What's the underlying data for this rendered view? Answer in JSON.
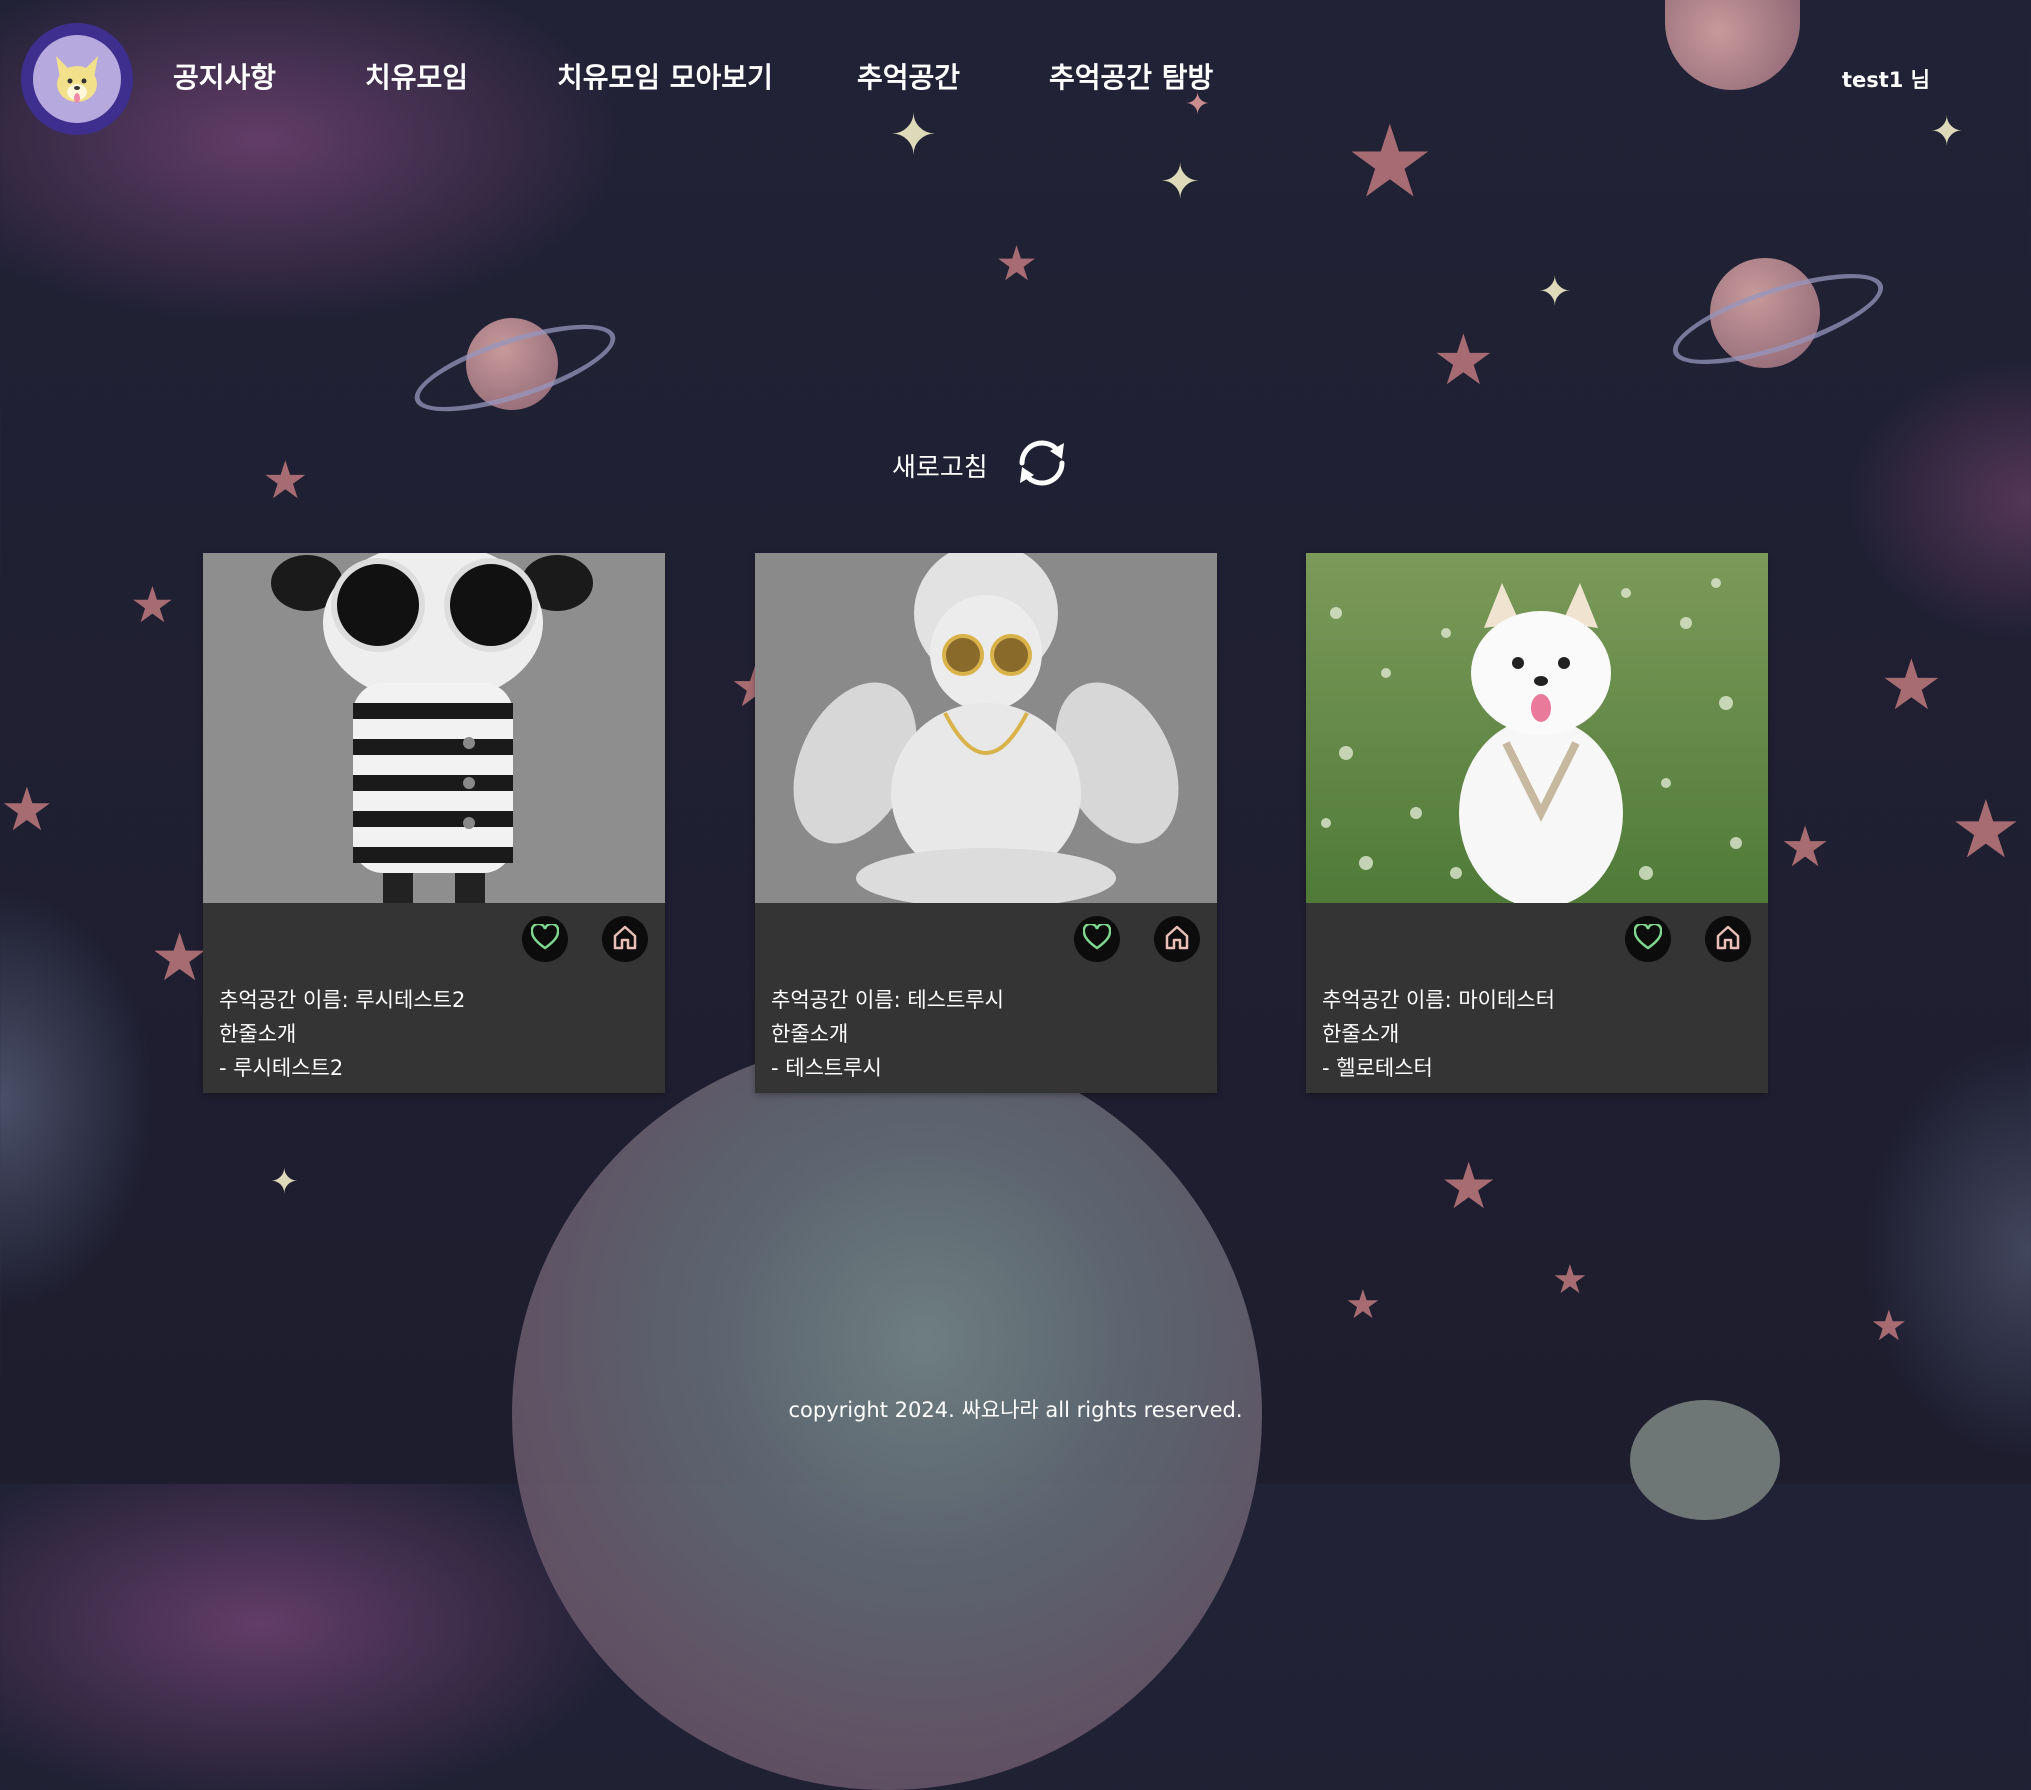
{
  "nav": {
    "logo_icon": "corgi-logo-icon",
    "items": [
      {
        "label": "공지사항"
      },
      {
        "label": "치유모임"
      },
      {
        "label": "치유모임 모아보기"
      },
      {
        "label": "추억공간"
      },
      {
        "label": "추억공간 탐방"
      }
    ],
    "user_label": "test1 님"
  },
  "refresh": {
    "label": "새로고침",
    "icon": "refresh-icon"
  },
  "cards": [
    {
      "image": "black-white-striped-figure-with-sunglasses",
      "name_line": "추억공간 이름: 루시테스트2",
      "intro_label": "한줄소개",
      "intro_text": "- 루시테스트2",
      "like_icon": "heart-icon",
      "home_icon": "home-icon"
    },
    {
      "image": "white-cherub-statue-with-sunglasses",
      "name_line": "추억공간 이름: 테스트루시",
      "intro_label": "한줄소개",
      "intro_text": "- 테스트루시",
      "like_icon": "heart-icon",
      "home_icon": "home-icon"
    },
    {
      "image": "white-pomeranian-dog-on-grass",
      "name_line": "추억공간 이름: 마이테스터",
      "intro_label": "한줄소개",
      "intro_text": "- 헬로테스터",
      "like_icon": "heart-icon",
      "home_icon": "home-icon"
    }
  ],
  "colors": {
    "background": "#1f1f30",
    "card": "#343434",
    "heart": "#7fd68f",
    "home": "#e9bfb7",
    "logo_ring": "#3e2f8f"
  },
  "footer": {
    "text": "copyright 2024. 싸요나라 all rights reserved."
  }
}
